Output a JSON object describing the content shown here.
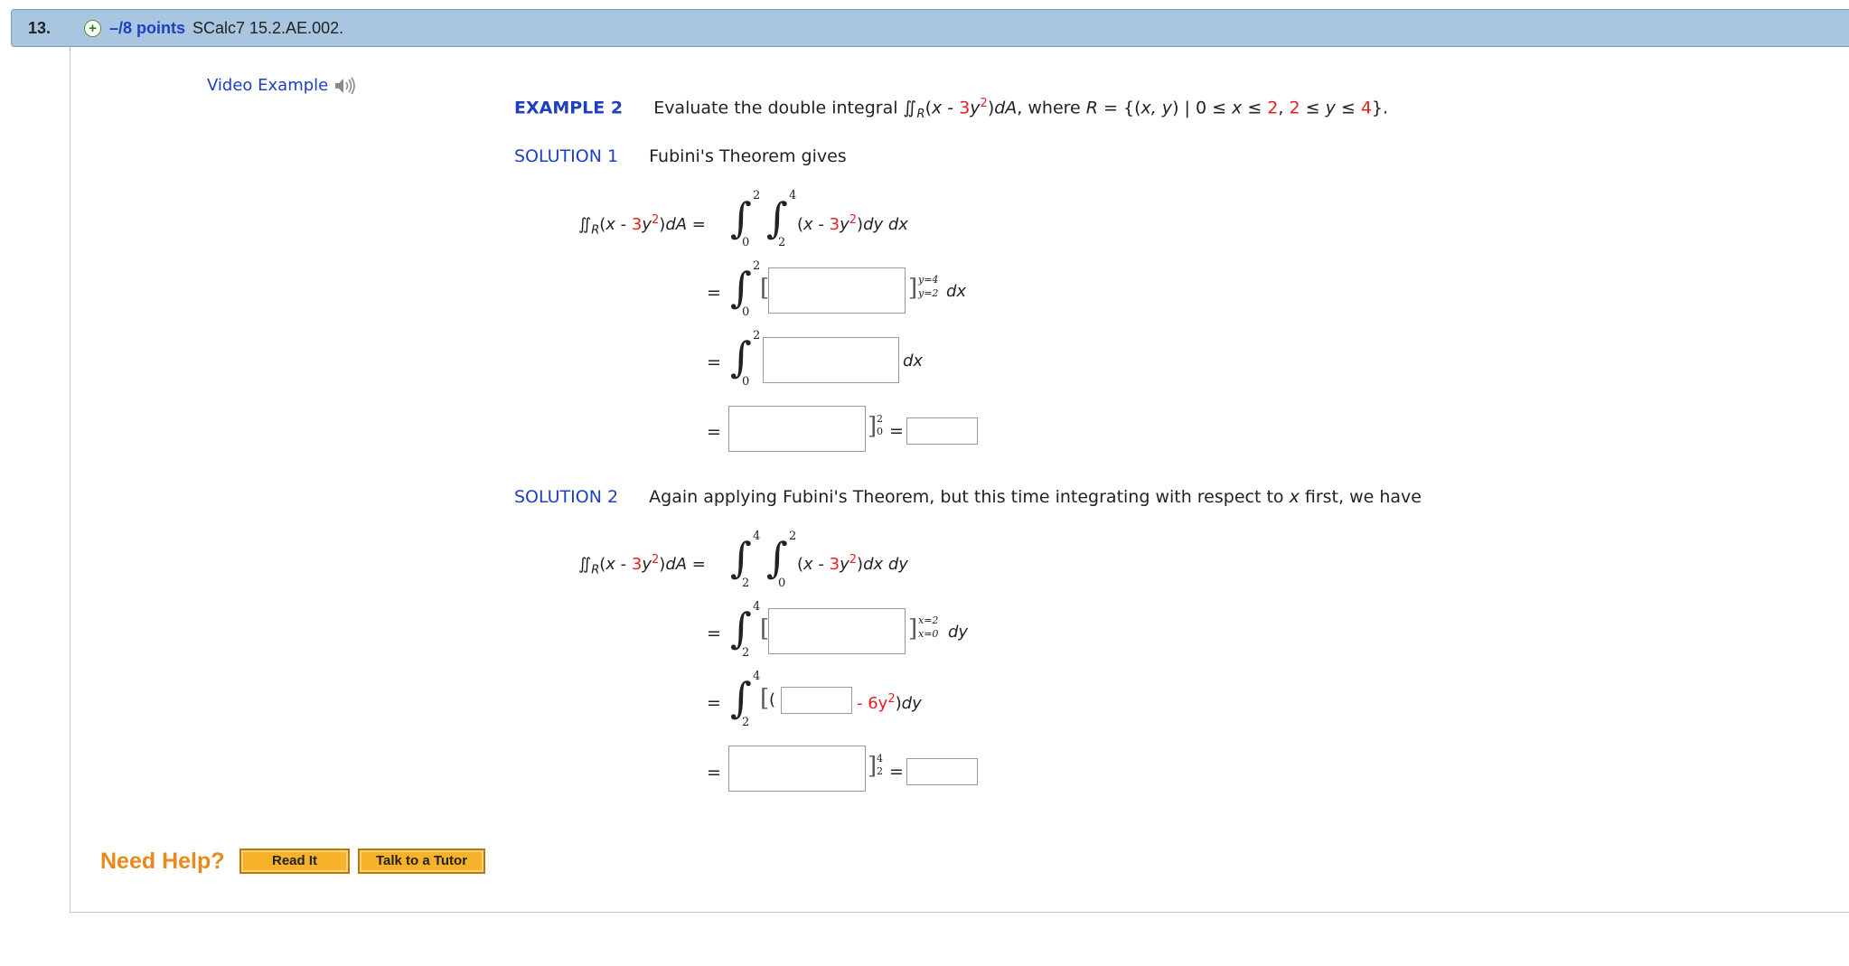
{
  "question": {
    "number": "13.",
    "points": "–/8 points",
    "code": "SCalc7 15.2.AE.002."
  },
  "video_example": "Video Example",
  "example": {
    "label": "EXAMPLE 2",
    "text_a": "Evaluate the double integral ∬",
    "sub_r": "R",
    "integrand_a": "(",
    "x": "x",
    "minus": " - ",
    "coef": "3",
    "y": "y",
    "exp2": "2",
    "integrand_b": ")",
    "da": "dA",
    "where": ", where ",
    "r": "R",
    "set_a": " = {(",
    "xy": "x, y",
    "set_b": ") | 0 ≤ ",
    "set_x": "x",
    "set_c": " ≤ ",
    "two": "2",
    "comma": ", ",
    "two2": "2",
    "set_d": " ≤ ",
    "set_y": "y",
    "set_e": " ≤ ",
    "four": "4",
    "set_f": "}."
  },
  "solution1": {
    "label": "SOLUTION 1",
    "text": "Fubini's Theorem gives"
  },
  "solution2": {
    "label": "SOLUTION 2",
    "text_a": "Again applying Fubini's Theorem, but this time integrating with respect to ",
    "text_x": "x",
    "text_b": " first, we have"
  },
  "math": {
    "lhs": "∬",
    "eq": "=",
    "dy_dx": "dy dx",
    "dx": "dx",
    "dx_dy": "dx dy",
    "dy": "dy",
    "six_y2": "- 6y",
    "lim_0": "0",
    "lim_2": "2",
    "lim_4": "4",
    "eval_y_top": "y=4",
    "eval_y_bot": "y=2",
    "eval_x_top": "x=2",
    "eval_x_bot": "x=0",
    "paren_open": "(",
    "paren_close": ")"
  },
  "help": {
    "label": "Need Help?",
    "read_it": "Read It",
    "tutor": "Talk to a Tutor"
  }
}
